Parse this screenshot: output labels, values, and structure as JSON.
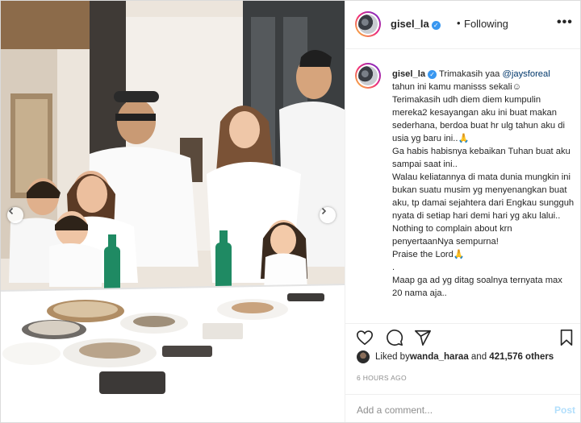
{
  "post": {
    "username": "gisel_la",
    "verified_icon": "verified-badge-icon",
    "separator": "•",
    "follow_status": "Following",
    "more_label": "•••"
  },
  "caption": {
    "username": "gisel_la",
    "mention": "@jaysforeal",
    "lead": "Trimakasih yaa ",
    "body": "tahun ini kamu manisss sekali☺\nTerimakasih udh diem diem kumpulin mereka2 kesayangan aku ini buat makan sederhana, berdoa buat hr ulg tahun aku di usia yg baru ini..🙏\nGa habis habisnya kebaikan Tuhan buat aku sampai saat ini..\nWalau keliatannya di mata dunia mungkin ini bukan suatu musim yg menyenangkan buat aku, tp damai sejahtera dari Engkau sungguh nyata di setiap hari demi hari yg aku lalui..\nNothing to complain about krn penyertaanNya sempurna!\nPraise the Lord🙏\n.\nMaap ga ad yg ditag soalnya ternyata max 20 nama aja.."
  },
  "actions": {
    "like_icon": "heart-icon",
    "comment_icon": "comment-icon",
    "share_icon": "paper-plane-icon",
    "save_icon": "bookmark-icon"
  },
  "likes": {
    "prefix": "Liked by ",
    "user": "wanda_haraa",
    "middle": " and ",
    "others": "421,576 others"
  },
  "timestamp": "6 HOURS AGO",
  "comment": {
    "placeholder": "Add a comment...",
    "post_label": "Post"
  },
  "colors": {
    "accent": "#3897f0",
    "link": "#00376b",
    "post_disabled": "#b2dffc",
    "muted": "#8e8e8e"
  }
}
